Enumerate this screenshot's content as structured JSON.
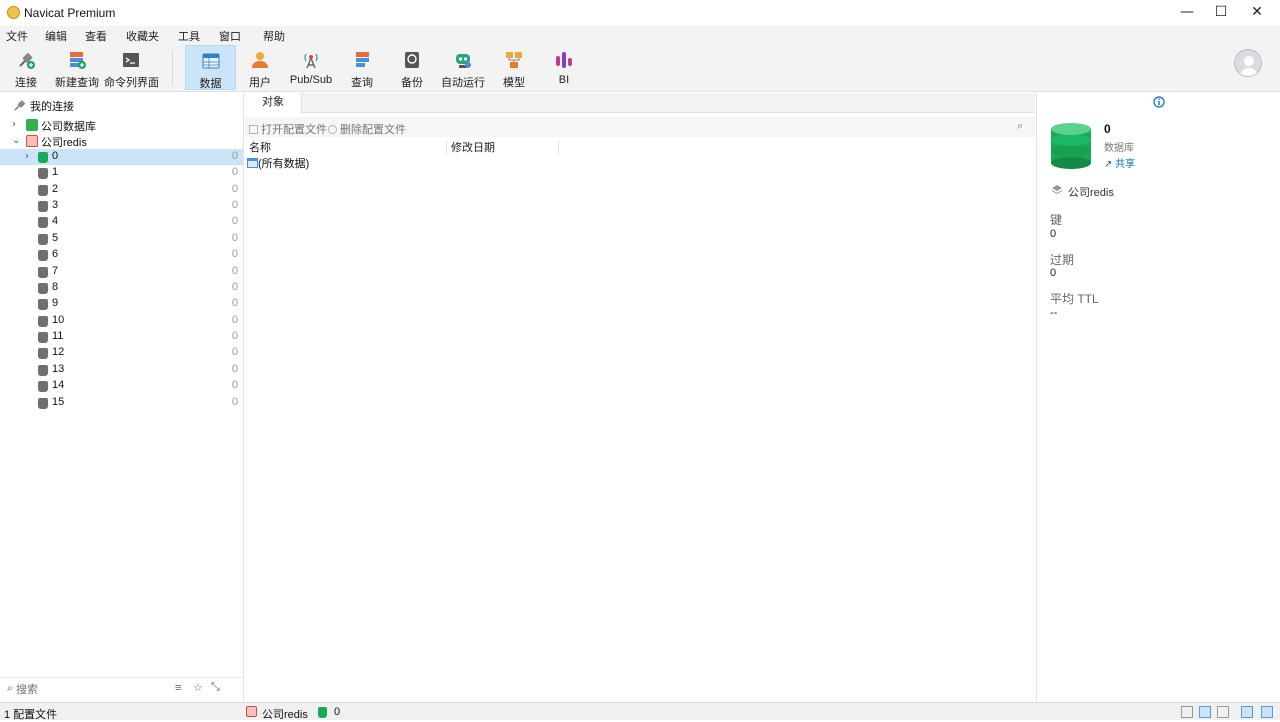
{
  "window": {
    "title": "Navicat Premium",
    "controls": {
      "minimize": "—",
      "maximize": "☐",
      "close": "✕"
    }
  },
  "menu": [
    "文件",
    "编辑",
    "查看",
    "收藏夹",
    "工具",
    "窗口",
    "帮助"
  ],
  "toolbar": {
    "connect": "连接",
    "new_query": "新建查询",
    "cli": "命令列界面",
    "data": "数据",
    "user": "用户",
    "pubsub": "Pub/Sub",
    "query": "查询",
    "backup": "备份",
    "automation": "自动运行",
    "model": "模型",
    "bi": "BI"
  },
  "sidebar": {
    "root": "我的连接",
    "conn1": "公司数据库",
    "conn2": "公司redis",
    "dbs": [
      {
        "name": "0",
        "count": "0"
      },
      {
        "name": "1",
        "count": "0"
      },
      {
        "name": "2",
        "count": "0"
      },
      {
        "name": "3",
        "count": "0"
      },
      {
        "name": "4",
        "count": "0"
      },
      {
        "name": "5",
        "count": "0"
      },
      {
        "name": "6",
        "count": "0"
      },
      {
        "name": "7",
        "count": "0"
      },
      {
        "name": "8",
        "count": "0"
      },
      {
        "name": "9",
        "count": "0"
      },
      {
        "name": "10",
        "count": "0"
      },
      {
        "name": "11",
        "count": "0"
      },
      {
        "name": "12",
        "count": "0"
      },
      {
        "name": "13",
        "count": "0"
      },
      {
        "name": "14",
        "count": "0"
      },
      {
        "name": "15",
        "count": "0"
      }
    ],
    "search_placeholder": "搜索"
  },
  "objects": {
    "tab": "对象",
    "open_profile": "打开配置文件",
    "delete_profile": "删除配置文件",
    "col_name": "名称",
    "col_modified": "修改日期",
    "rows": [
      "(所有数据)"
    ]
  },
  "info": {
    "db_number": "0",
    "db_type": "数据库",
    "share": "共享",
    "connection": "公司redis",
    "keys_label": "键",
    "keys_value": "0",
    "expire_label": "过期",
    "expire_value": "0",
    "ttl_label": "平均 TTL",
    "ttl_value": "--"
  },
  "status": {
    "profiles": "1 配置文件",
    "connection": "公司redis",
    "db": "0"
  },
  "colors": {
    "selection": "#cce4f7",
    "redis": "#e0463a",
    "db_green": "#1aa95a",
    "accent": "#0a6cc2"
  }
}
